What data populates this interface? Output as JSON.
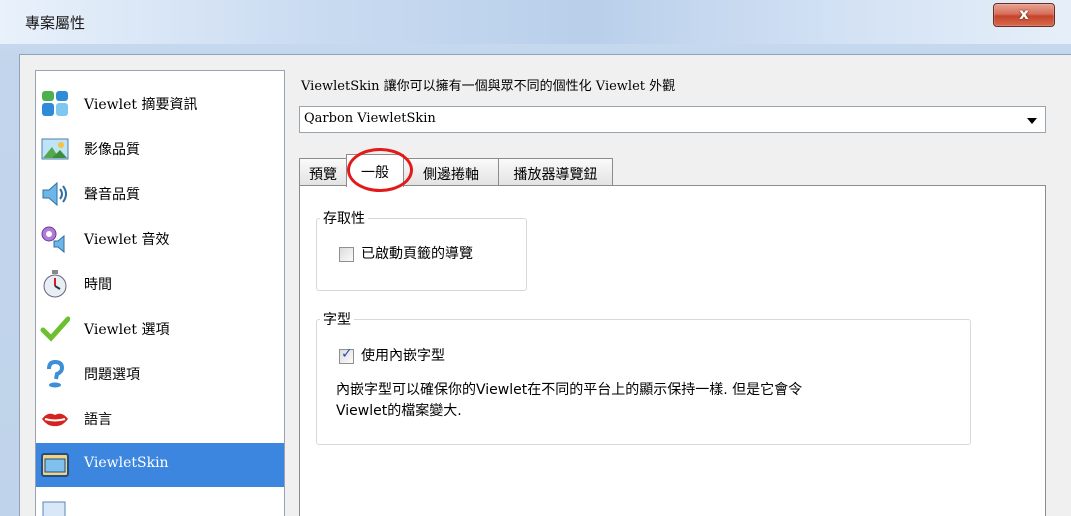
{
  "window": {
    "title": "專案屬性",
    "close_label": "x"
  },
  "sidebar": {
    "items": [
      {
        "label": "Viewlet 摘要資訊",
        "icon": "summary-info-icon"
      },
      {
        "label": "影像品質",
        "icon": "image-quality-icon"
      },
      {
        "label": "聲音品質",
        "icon": "sound-quality-icon"
      },
      {
        "label": "Viewlet 音效",
        "icon": "sound-effects-icon"
      },
      {
        "label": "時間",
        "icon": "stopwatch-icon"
      },
      {
        "label": "Viewlet 選項",
        "icon": "checkmark-icon"
      },
      {
        "label": "問題選項",
        "icon": "question-icon"
      },
      {
        "label": "語言",
        "icon": "lips-icon"
      },
      {
        "label": "ViewletSkin",
        "icon": "skin-window-icon",
        "selected": true
      },
      {
        "label": "",
        "icon": "doc-icon"
      }
    ]
  },
  "main": {
    "intro": "ViewletSkin 讓你可以擁有一個與眾不同的個性化 Viewlet 外觀",
    "skin_select": {
      "value": "Qarbon ViewletSkin"
    },
    "tabs": [
      {
        "label": "預覽"
      },
      {
        "label": "一般",
        "active": true
      },
      {
        "label": "側邊捲軸"
      },
      {
        "label": "播放器導覽鈕"
      }
    ],
    "accessibility": {
      "title": "存取性",
      "checkbox_label": "已啟動頁籤的導覽",
      "checked": false
    },
    "font": {
      "title": "字型",
      "checkbox_label": "使用內嵌字型",
      "checked": true,
      "description_line1": "內嵌字型可以確保你的Viewlet在不同的平台上的顯示保持一樣. 但是它會令",
      "description_line2": "Viewlet的檔案變大."
    }
  },
  "colors": {
    "selection": "#3d86e0",
    "annotation": "#e21a1a",
    "close_button": "#c4442b"
  }
}
